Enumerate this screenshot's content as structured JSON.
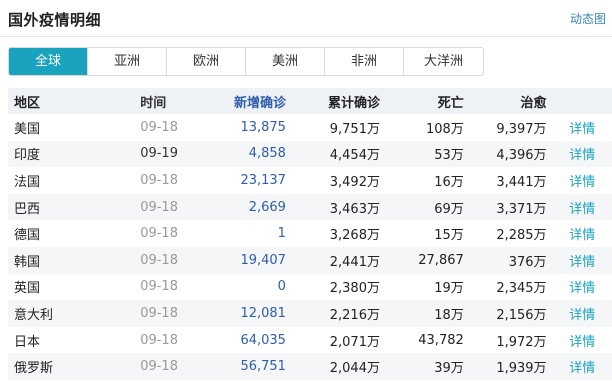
{
  "header": {
    "title": "国外疫情明细",
    "anim_link": "动态图"
  },
  "tabs": [
    {
      "label": "全球",
      "active": true
    },
    {
      "label": "亚洲",
      "active": false
    },
    {
      "label": "欧洲",
      "active": false
    },
    {
      "label": "美洲",
      "active": false
    },
    {
      "label": "非洲",
      "active": false
    },
    {
      "label": "大洋洲",
      "active": false
    }
  ],
  "table": {
    "headers": [
      "地区",
      "时间",
      "新增确诊",
      "累计确诊",
      "死亡",
      "治愈"
    ],
    "rows": [
      {
        "region": "美国",
        "time": "09-18",
        "new": "13,875",
        "total": "9,751万",
        "death": "108万",
        "cured": "9,397万",
        "detail": "详情"
      },
      {
        "region": "印度",
        "time": "09-19",
        "new": "4,858",
        "total": "4,454万",
        "death": "53万",
        "cured": "4,396万",
        "detail": "详情"
      },
      {
        "region": "法国",
        "time": "09-18",
        "new": "23,137",
        "total": "3,492万",
        "death": "16万",
        "cured": "3,441万",
        "detail": "详情"
      },
      {
        "region": "巴西",
        "time": "09-18",
        "new": "2,669",
        "total": "3,463万",
        "death": "69万",
        "cured": "3,371万",
        "detail": "详情"
      },
      {
        "region": "德国",
        "time": "09-18",
        "new": "1",
        "total": "3,268万",
        "death": "15万",
        "cured": "2,285万",
        "detail": "详情"
      },
      {
        "region": "韩国",
        "time": "09-18",
        "new": "19,407",
        "total": "2,441万",
        "death": "27,867",
        "cured": "376万",
        "detail": "详情"
      },
      {
        "region": "英国",
        "time": "09-18",
        "new": "0",
        "total": "2,380万",
        "death": "19万",
        "cured": "2,345万",
        "detail": "详情"
      },
      {
        "region": "意大利",
        "time": "09-18",
        "new": "12,081",
        "total": "2,216万",
        "death": "18万",
        "cured": "2,156万",
        "detail": "详情"
      },
      {
        "region": "日本",
        "time": "09-18",
        "new": "64,035",
        "total": "2,071万",
        "death": "43,782",
        "cured": "1,972万",
        "detail": "详情"
      },
      {
        "region": "俄罗斯",
        "time": "09-18",
        "new": "56,751",
        "total": "2,044万",
        "death": "39万",
        "cured": "1,939万",
        "detail": "详情"
      }
    ]
  },
  "colors": {
    "accent": "#1aa3bf",
    "new_cases": "#2f5ea8",
    "header_bg": "#eef1f5"
  }
}
